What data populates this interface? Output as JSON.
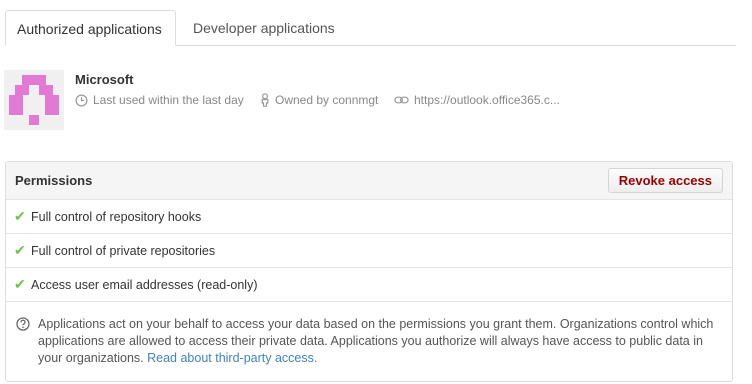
{
  "tabs": [
    {
      "label": "Authorized applications",
      "active": true
    },
    {
      "label": "Developer applications",
      "active": false
    }
  ],
  "app": {
    "name": "Microsoft",
    "avatar_color": "#e27ad5",
    "last_used": "Last used within the last day",
    "owner": "Owned by connmgt",
    "url": "https://outlook.office365.c..."
  },
  "permissions": {
    "title": "Permissions",
    "revoke_label": "Revoke access",
    "items": [
      "Full control of repository hooks",
      "Full control of private repositories",
      "Access user email addresses (read-only)"
    ],
    "note_text": "Applications act on your behalf to access your data based on the permissions you grant them. Organizations control which applications are allowed to access their private data. Applications you authorize will always have access to public data in your organizations.",
    "note_link": "Read about third-party access."
  },
  "colors": {
    "check": "#6cc644",
    "revoke": "#990000",
    "link": "#4183c4"
  },
  "icons": {
    "clock": "clock-icon",
    "owner": "person-icon",
    "link": "link-icon",
    "check": "check-icon",
    "question": "question-icon"
  }
}
